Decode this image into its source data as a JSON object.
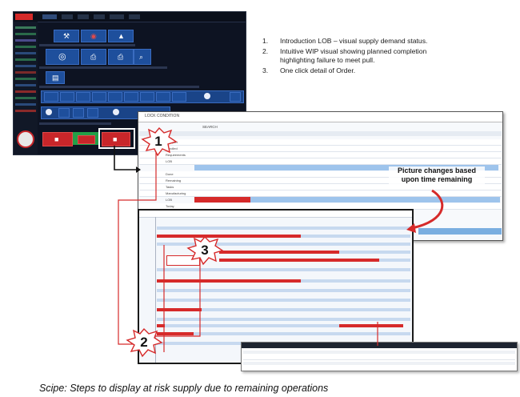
{
  "steps": [
    {
      "number": "1.",
      "text": "Introduction LOB – visual supply demand status."
    },
    {
      "number": "2.",
      "text": "Intuitive WIP visual showing planned completion highlighting failure to meet pull."
    },
    {
      "number": "3.",
      "text": "One click detail of Order."
    }
  ],
  "steps_lines": {
    "step2_line1": "Intuitive WIP visual showing planned completion",
    "step2_line2": "highlighting failure to meet pull."
  },
  "callouts": {
    "one": "1",
    "two": "2",
    "three": "3",
    "note_line1": "Picture changes based",
    "note_line2": "upon time remaining"
  },
  "shot2": {
    "title": "LOCK CONDITION",
    "tab": "SEARCH",
    "row_labels": [
      "Complet",
      "Enrolled",
      "Requirements",
      "LOB",
      "Done",
      "Remaining",
      "Tasks",
      "Manufacturing",
      "LOB",
      "Today"
    ]
  },
  "caption": "Scipe: Steps to display at risk supply due to remaining operations",
  "colors": {
    "dark_bg": "#0d1322",
    "tile_blue": "#1e4f9c",
    "alert_red": "#d62a2a",
    "ok_green": "#23a048",
    "bar_blue": "#c7d9ef"
  },
  "icons": [
    "wrench-icon",
    "target-icon",
    "printer-icon",
    "search-icon",
    "gear-icon",
    "document-icon"
  ]
}
